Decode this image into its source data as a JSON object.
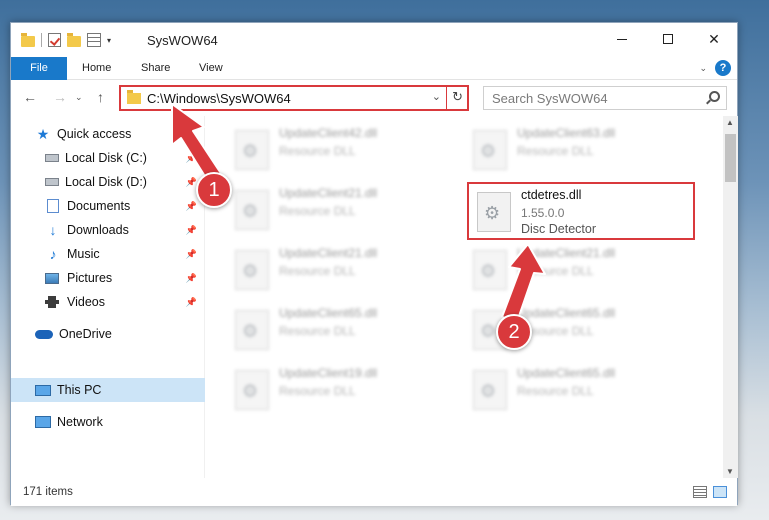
{
  "window": {
    "title": "SysWOW64",
    "buttons": {
      "minimize": "minimize-icon",
      "maximize": "maximize-icon",
      "close": "✕"
    }
  },
  "ribbon": {
    "tabs": [
      "File",
      "Home",
      "Share",
      "View"
    ],
    "help": "?"
  },
  "address": {
    "path": "C:\\Windows\\SysWOW64",
    "search_placeholder": "Search SysWOW64"
  },
  "sidebar": {
    "items": [
      {
        "label": "Quick access",
        "icon": "star-icon"
      },
      {
        "label": "Local Disk (C:)",
        "icon": "drive-icon",
        "pinned": true
      },
      {
        "label": "Local Disk (D:)",
        "icon": "drive-icon",
        "pinned": true
      },
      {
        "label": "Documents",
        "icon": "documents-icon",
        "pinned": true
      },
      {
        "label": "Downloads",
        "icon": "download-icon",
        "pinned": true
      },
      {
        "label": "Music",
        "icon": "music-icon",
        "pinned": true
      },
      {
        "label": "Pictures",
        "icon": "pictures-icon",
        "pinned": true
      },
      {
        "label": "Videos",
        "icon": "videos-icon",
        "pinned": true
      },
      {
        "label": "OneDrive",
        "icon": "onedrive-icon"
      },
      {
        "label": "This PC",
        "icon": "this-pc-icon",
        "selected": true
      },
      {
        "label": "Network",
        "icon": "network-icon"
      }
    ]
  },
  "files": [
    {
      "name": "UpdateClient42.dll",
      "type": "Resource DLL"
    },
    {
      "name": "UpdateClient63.dll",
      "type": "Resource DLL"
    },
    {
      "name": "UpdateClient21.dll",
      "type": "Resource DLL"
    },
    {
      "name": "ctdetres.dll",
      "version": "1.55.0.0",
      "description": "Disc Detector"
    },
    {
      "name": "UpdateClient21.dll",
      "type": "Resource DLL"
    },
    {
      "name": "UpdateClient21.dll",
      "type": "Resource DLL"
    },
    {
      "name": "UpdateClient65.dll",
      "type": "Resource DLL"
    },
    {
      "name": "UpdateClient65.dll",
      "type": "Resource DLL"
    },
    {
      "name": "UpdateClient19.dll",
      "type": "Resource DLL"
    },
    {
      "name": "UpdateClient65.dll",
      "type": "Resource DLL"
    }
  ],
  "status": {
    "item_count": "171 items"
  },
  "annotations": {
    "step1": "1",
    "step2": "2",
    "color": "#d9393c"
  }
}
